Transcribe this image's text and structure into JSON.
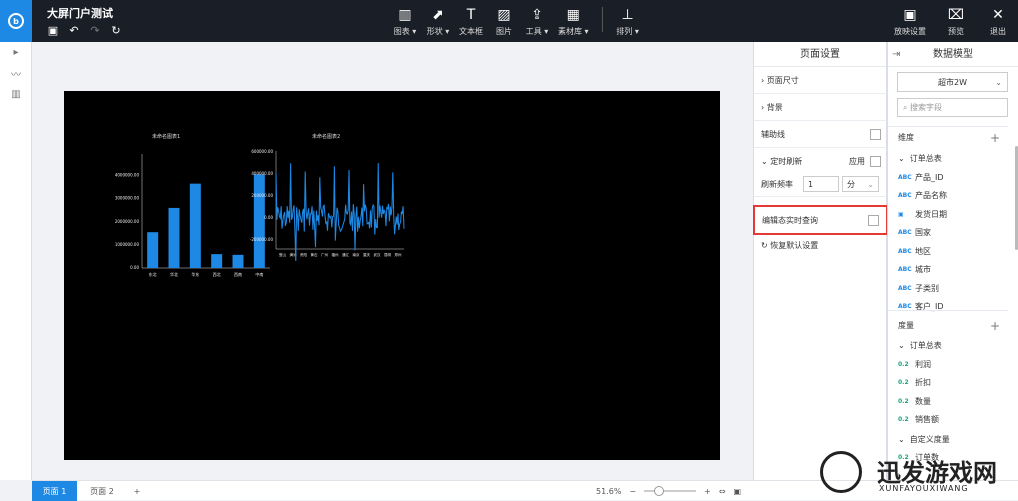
{
  "app": {
    "logo": "b-logo",
    "title": "大屏门户测试"
  },
  "toolbar": {
    "items": [
      {
        "label": "图表 ▾",
        "icon": "chart-icon",
        "glyph": "▥"
      },
      {
        "label": "形状 ▾",
        "icon": "shape-icon",
        "glyph": "⬈"
      },
      {
        "label": "文本框",
        "icon": "text-icon",
        "glyph": "T"
      },
      {
        "label": "图片",
        "icon": "image-icon",
        "glyph": "▨"
      },
      {
        "label": "工具 ▾",
        "icon": "tool-icon",
        "glyph": "⇪"
      },
      {
        "label": "素材库 ▾",
        "icon": "library-icon",
        "glyph": "▦"
      },
      {
        "label": "排列 ▾",
        "icon": "arrange-icon",
        "glyph": "⊥"
      }
    ],
    "right": [
      {
        "label": "放映设置",
        "icon": "play-settings-icon",
        "glyph": "▣"
      },
      {
        "label": "预览",
        "icon": "preview-icon",
        "glyph": "⌧"
      },
      {
        "label": "退出",
        "icon": "exit-icon",
        "glyph": "✕"
      }
    ]
  },
  "canvas": {
    "chart1": {
      "title": "未命名图表1",
      "type": "bar",
      "categories": [
        "东北",
        "华北",
        "华东",
        "西北",
        "西南",
        "中南"
      ],
      "values": [
        1550000,
        2600000,
        3650000,
        600000,
        570000,
        4050000
      ],
      "ylim": [
        0,
        4500000
      ],
      "ticks": [
        "0.00",
        "1000000.00",
        "2000000.00",
        "3000000.00",
        "4000000.00"
      ],
      "color": "#1e88e5"
    },
    "chart2": {
      "title": "未命名图表2",
      "type": "line",
      "x_labels": [
        "登山",
        "满洲",
        "贵阳",
        "黄石",
        "广州",
        "福州",
        "通辽",
        "南京",
        "重庆",
        "武汉",
        "昆明",
        "郑州"
      ],
      "ticks": [
        "-200000.00",
        "0.00",
        "200000.00",
        "400000.00",
        "600000.00"
      ],
      "color": "#1e88e5"
    }
  },
  "properties": {
    "title": "页面设置",
    "page_size": "页面尺寸",
    "background": "背景",
    "guides": "辅助线",
    "timed_refresh": "定时刷新",
    "apply": "应用",
    "refresh_frequency": "刷新频率",
    "frequency_value": "1",
    "frequency_unit": "分",
    "realtime_query": "编辑态实时查询",
    "restore_default": "恢复默认设置"
  },
  "model": {
    "title": "数据模型",
    "dataset": "超市2W",
    "search_placeholder": "搜索字段",
    "dimension_title": "维度",
    "dimension_group": "订单总表",
    "dimensions": [
      "产品_ID",
      "产品名称",
      "发货日期",
      "国家",
      "地区",
      "城市",
      "子类别",
      "客户_ID"
    ],
    "measure_title": "度量",
    "measure_group": "订单总表",
    "measures": [
      "利润",
      "折扣",
      "数量",
      "销售额"
    ],
    "custom_measure": "自定义度量",
    "custom_item": "订单数"
  },
  "status": {
    "tab1": "页面 1",
    "tab2": "页面 2",
    "add": "+",
    "zoom": "51.6%"
  },
  "watermark": {
    "title": "迅发游戏网",
    "subtitle": "XUNFAYOUXIWANG"
  },
  "colors": {
    "accent": "#1e88e5",
    "highlight": "#e53935",
    "topbar": "#1a1e27"
  }
}
